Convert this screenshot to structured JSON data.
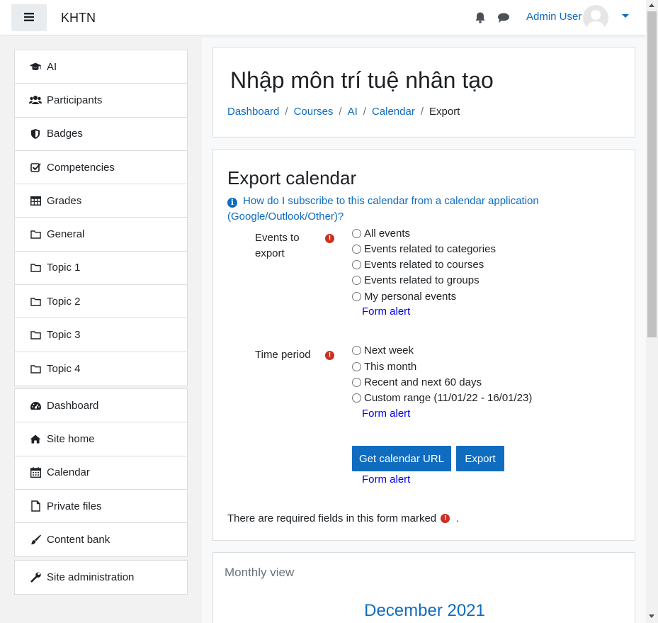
{
  "navbar": {
    "site_name": "KHTN",
    "user_name": "Admin User",
    "icons": [
      "menu-icon",
      "bell-icon",
      "chat-icon",
      "avatar",
      "caret-down-icon"
    ]
  },
  "sidebar": {
    "course_items": [
      {
        "label": "AI",
        "icon": "graduation-cap-icon"
      },
      {
        "label": "Participants",
        "icon": "users-icon"
      },
      {
        "label": "Badges",
        "icon": "shield-icon"
      },
      {
        "label": "Competencies",
        "icon": "checkbox-icon"
      },
      {
        "label": "Grades",
        "icon": "table-icon"
      },
      {
        "label": "General",
        "icon": "folder-icon"
      },
      {
        "label": "Topic 1",
        "icon": "folder-icon"
      },
      {
        "label": "Topic 2",
        "icon": "folder-icon"
      },
      {
        "label": "Topic 3",
        "icon": "folder-icon"
      },
      {
        "label": "Topic 4",
        "icon": "folder-icon"
      }
    ],
    "site_items": [
      {
        "label": "Dashboard",
        "icon": "dashboard-icon"
      },
      {
        "label": "Site home",
        "icon": "home-icon"
      },
      {
        "label": "Calendar",
        "icon": "calendar-icon"
      },
      {
        "label": "Private files",
        "icon": "file-icon"
      },
      {
        "label": "Content bank",
        "icon": "brush-icon"
      }
    ],
    "admin_items": [
      {
        "label": "Site administration",
        "icon": "wrench-icon"
      }
    ]
  },
  "header": {
    "course_title": "Nhập môn trí tuệ nhân tạo",
    "breadcrumb": [
      "Dashboard",
      "Courses",
      "AI",
      "Calendar",
      "Export"
    ]
  },
  "export": {
    "title": "Export calendar",
    "help_link": "How do I subscribe to this calendar from a calendar application (Google/Outlook/Other)?",
    "events_label": "Events to export",
    "events_options": [
      "All events",
      "Events related to categories",
      "Events related to courses",
      "Events related to groups",
      "My personal events"
    ],
    "time_label": "Time period",
    "time_options": [
      "Next week",
      "This month",
      "Recent and next 60 days",
      "Custom range (11/01/22 - 16/01/23)"
    ],
    "form_alert": "Form alert",
    "get_url_button": "Get calendar URL",
    "export_button": "Export",
    "required_note_before": "There are required fields in this form marked",
    "required_note_after": "."
  },
  "monthly": {
    "title": "Monthly view",
    "month": "December 2021"
  },
  "colors": {
    "link": "#0f6cbf",
    "button": "#0f6cbf",
    "required": "#ca3120",
    "form_alert": "#0000ee"
  }
}
